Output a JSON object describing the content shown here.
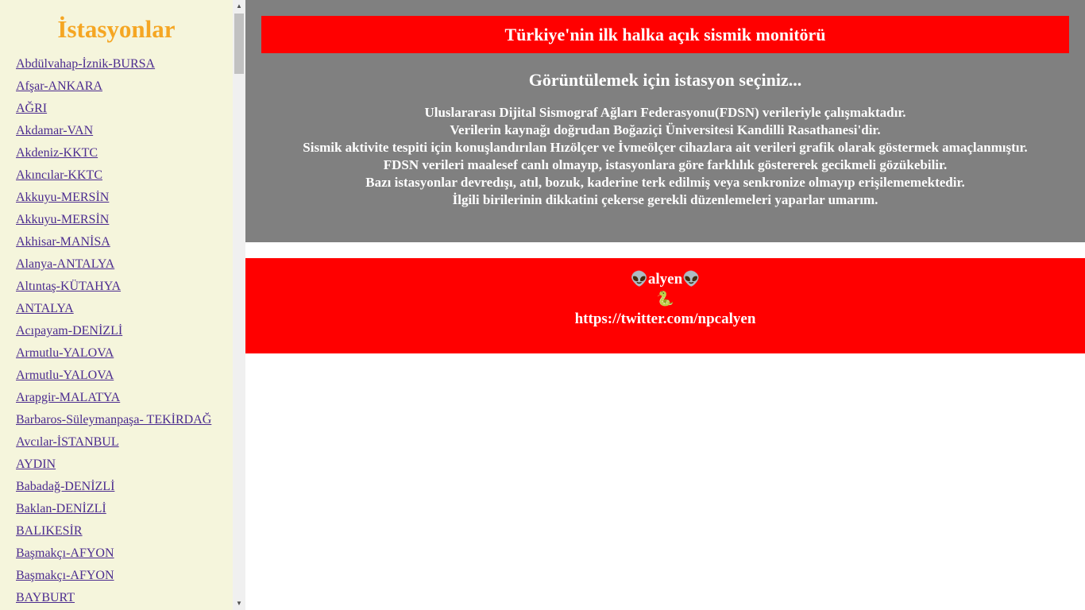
{
  "sidebar": {
    "title": "İstasyonlar",
    "stations": [
      "Abdülvahap-İznik-BURSA",
      "Afşar-ANKARA",
      "AĞRI",
      "Akdamar-VAN",
      "Akdeniz-KKTC",
      "Akıncılar-KKTC",
      "Akkuyu-MERSİN",
      "Akkuyu-MERSİN",
      "Akhisar-MANİSA",
      "Alanya-ANTALYA",
      "Altıntaş-KÜTAHYA",
      "ANTALYA",
      "Acıpayam-DENİZLİ",
      "Armutlu-YALOVA",
      "Armutlu-YALOVA",
      "Arapgir-MALATYA",
      "Barbaros-Süleymanpaşa- TEKİRDAĞ",
      "Avcılar-İSTANBUL",
      "AYDIN",
      "Babadağ-DENİZLİ",
      "Baklan-DENİZLİ",
      "BALIKESİR",
      "Başmakçı-AFYON",
      "Başmakçı-AFYON",
      "BAYBURT"
    ]
  },
  "header": {
    "title": "Türkiye'nin ilk halka açık sismik monitörü",
    "subtitle": "Görüntülemek için istasyon seçiniz...",
    "lines": [
      "Uluslararası Dijital Sismograf Ağları Federasyonu(FDSN) verileriyle çalışmaktadır.",
      "Verilerin kaynağı doğrudan Boğaziçi Üniversitesi Kandilli Rasathanesi'dir.",
      "Sismik aktivite tespiti için konuşlandırılan Hızölçer ve İvmeölçer cihazlara ait verileri grafik olarak göstermek amaçlanmıştır.",
      "FDSN verileri maalesef canlı olmayıp, istasyonlara göre farklılık göstererek gecikmeli gözükebilir.",
      "Bazı istasyonlar devredışı, atıl, bozuk, kaderine terk edilmiş veya senkronize olmayıp erişilememektedir.",
      "İlgili birilerinin dikkatini çekerse gerekli düzenlemeleri yaparlar umarım."
    ]
  },
  "footer": {
    "alien_icon": "👽",
    "name": "alyen",
    "snake_icon": "🐍",
    "link": "https://twitter.com/npcalyen"
  },
  "colors": {
    "sidebar_bg": "#f5f5dc",
    "title_color": "#f5a623",
    "red": "#ff0000",
    "gray": "#808080",
    "link": "#4b2b8f"
  }
}
